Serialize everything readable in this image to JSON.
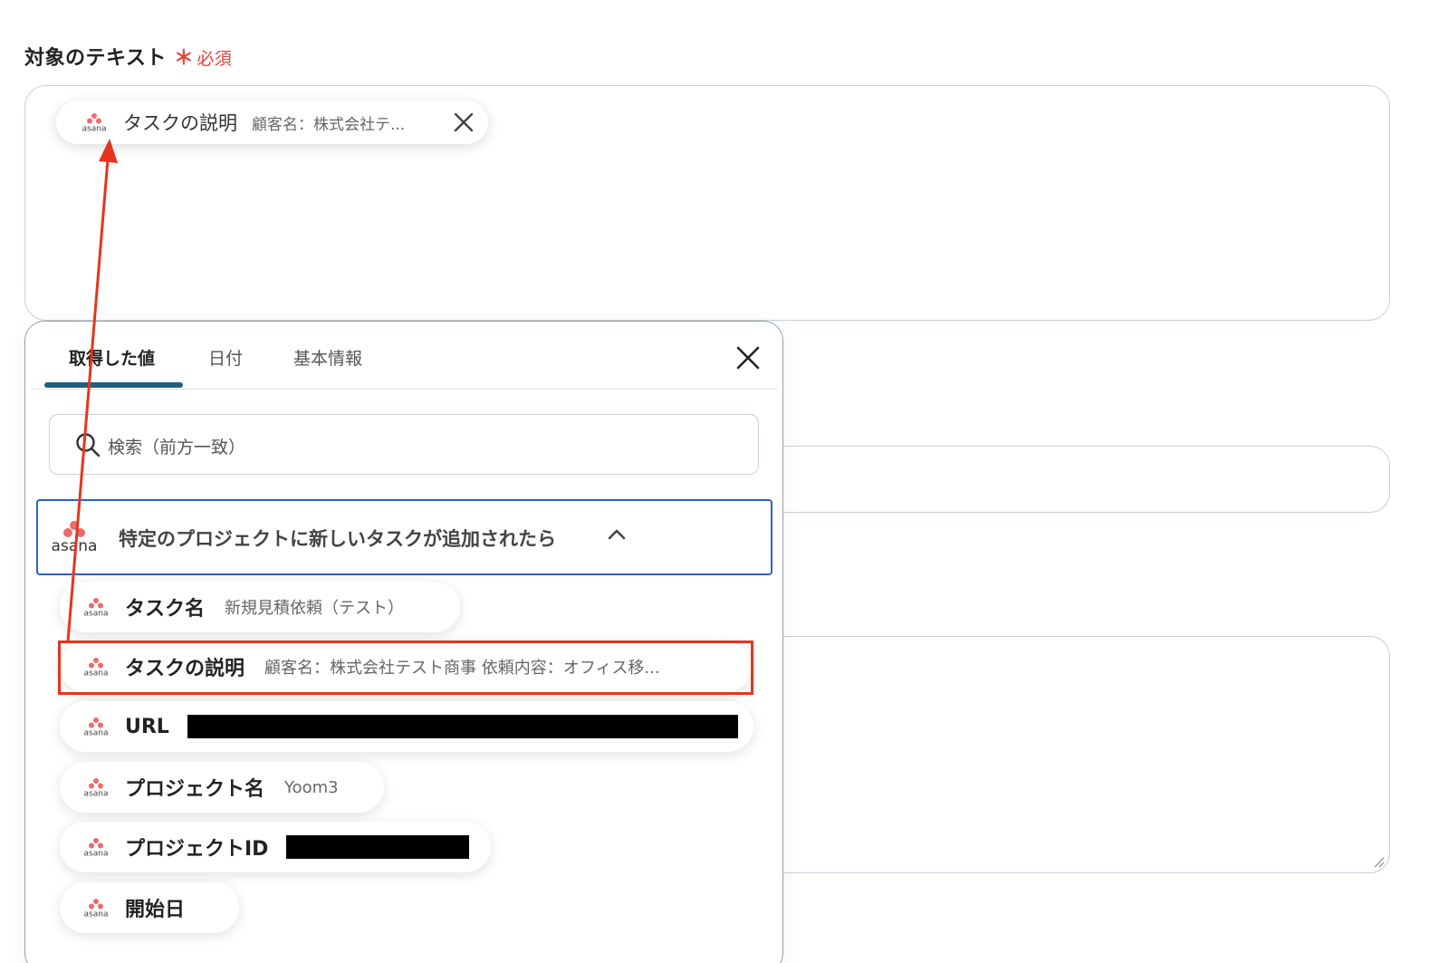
{
  "field": {
    "label": "対象のテキスト",
    "required_mark": "＊",
    "required_text": "必須"
  },
  "selected_chip": {
    "icon": "asana-icon",
    "label": "タスクの説明",
    "value": "顧客名：株式会社テ..."
  },
  "popup": {
    "tabs": [
      {
        "label": "取得した値",
        "active": true
      },
      {
        "label": "日付",
        "active": false
      },
      {
        "label": "基本情報",
        "active": false
      }
    ],
    "search": {
      "placeholder": "検索（前方一致）"
    },
    "group": {
      "icon": "asana-logo",
      "title": "特定のプロジェクトに新しいタスクが追加されたら",
      "expanded": true
    },
    "items": [
      {
        "label": "タスク名",
        "value": "新規見積依頼（テスト）"
      },
      {
        "label": "タスクの説明",
        "value": "顧客名：株式会社テスト商事 依頼内容：オフィス移...",
        "highlighted": true
      },
      {
        "label": "URL",
        "value_redacted": true
      },
      {
        "label": "プロジェクト名",
        "value": "Yoom3"
      },
      {
        "label": "プロジェクトID",
        "value_redacted": true
      },
      {
        "label": "開始日",
        "value": ""
      }
    ]
  },
  "colors": {
    "required": "#e5433b",
    "tab_active_underline": "#1f5f7d",
    "group_border": "#2d5fd1",
    "annotation": "#e8341c",
    "asana_coral": "#f06a6a"
  },
  "asana_wordmark": "asana"
}
